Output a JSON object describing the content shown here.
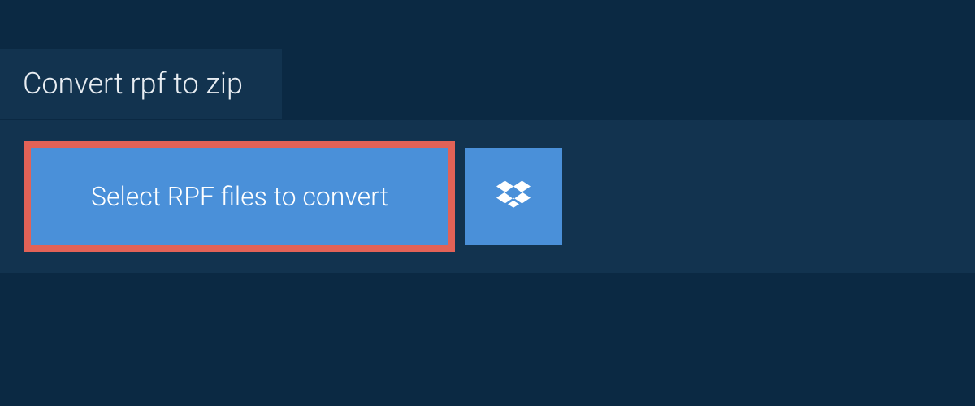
{
  "tab": {
    "title": "Convert rpf to zip"
  },
  "panel": {
    "select_label": "Select RPF files to convert",
    "dropbox_icon": "dropbox-icon"
  },
  "colors": {
    "background": "#0b2943",
    "panel": "#12334f",
    "button": "#4a90d9",
    "highlight": "#e26257",
    "text_light": "#e8edf2",
    "text_white": "#ffffff"
  }
}
